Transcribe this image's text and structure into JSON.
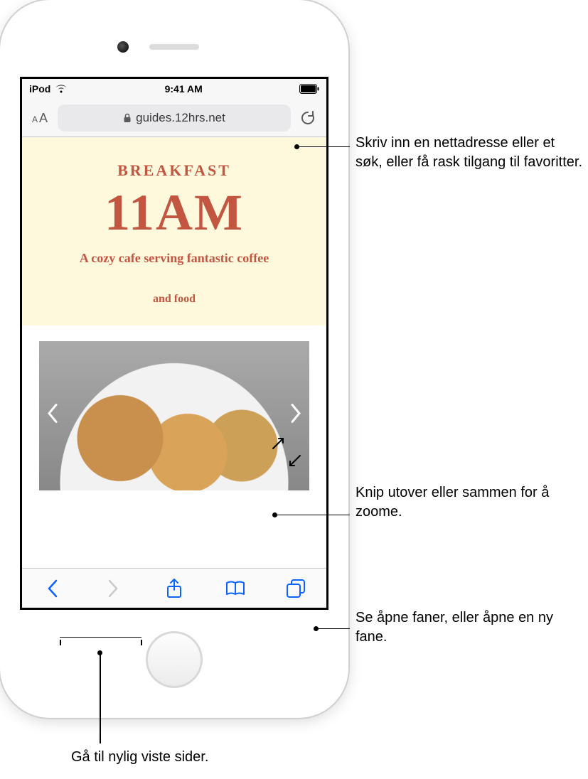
{
  "status": {
    "carrier": "iPod",
    "time": "9:41 AM"
  },
  "address_bar": {
    "url": "guides.12hrs.net"
  },
  "page": {
    "kicker": "BREAKFAST",
    "title": "11AM",
    "subtitle": "A cozy cafe serving fantastic coffee",
    "tagline": "and food"
  },
  "callouts": {
    "address": "Skriv inn en nettadresse eller et søk, eller få rask tilgang til favoritter.",
    "pinch": "Knip utover eller sammen for å zoome.",
    "tabs": "Se åpne faner, eller åpne en ny fane.",
    "history": "Gå til nylig viste sider."
  }
}
